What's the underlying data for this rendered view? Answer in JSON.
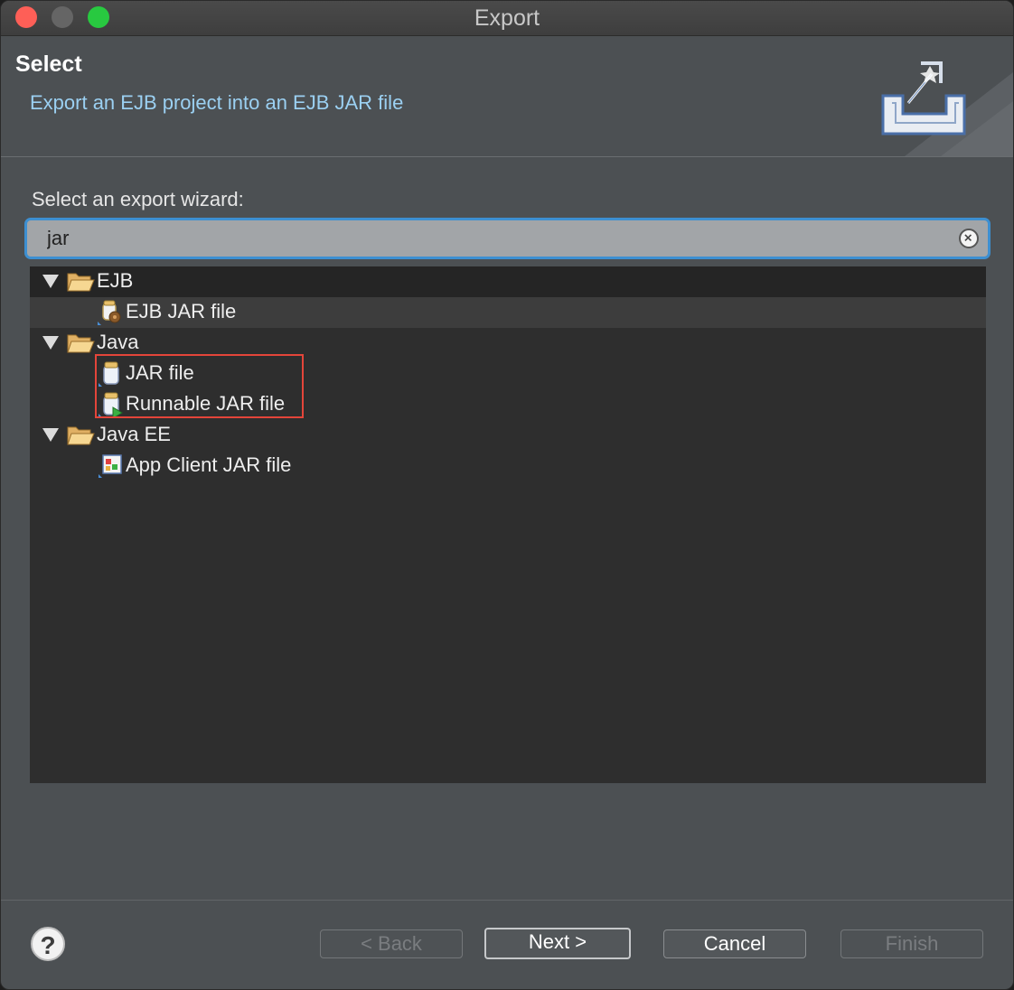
{
  "window": {
    "title": "Export"
  },
  "header": {
    "title": "Select",
    "description": "Export an EJB project into an EJB JAR file",
    "banner_icon": "export-wizard-banner-icon"
  },
  "body": {
    "label": "Select an export wizard:",
    "search": {
      "value": "jar",
      "placeholder": ""
    }
  },
  "tree": {
    "groups": [
      {
        "label": "EJB",
        "expanded": true,
        "children": [
          {
            "label": "EJB JAR file",
            "icon": "ejb-jar-icon",
            "selected": true
          }
        ]
      },
      {
        "label": "Java",
        "expanded": true,
        "children": [
          {
            "label": "JAR file",
            "icon": "jar-icon"
          },
          {
            "label": "Runnable JAR file",
            "icon": "runnable-jar-icon"
          }
        ]
      },
      {
        "label": "Java EE",
        "expanded": true,
        "children": [
          {
            "label": "App Client JAR file",
            "icon": "app-client-jar-icon"
          }
        ]
      }
    ]
  },
  "buttons": {
    "help": "?",
    "back": "< Back",
    "next": "Next >",
    "cancel": "Cancel",
    "finish": "Finish"
  },
  "colors": {
    "accent": "#3d8fd1",
    "highlight_box": "#e4453a",
    "description_text": "#9bd0f2"
  }
}
